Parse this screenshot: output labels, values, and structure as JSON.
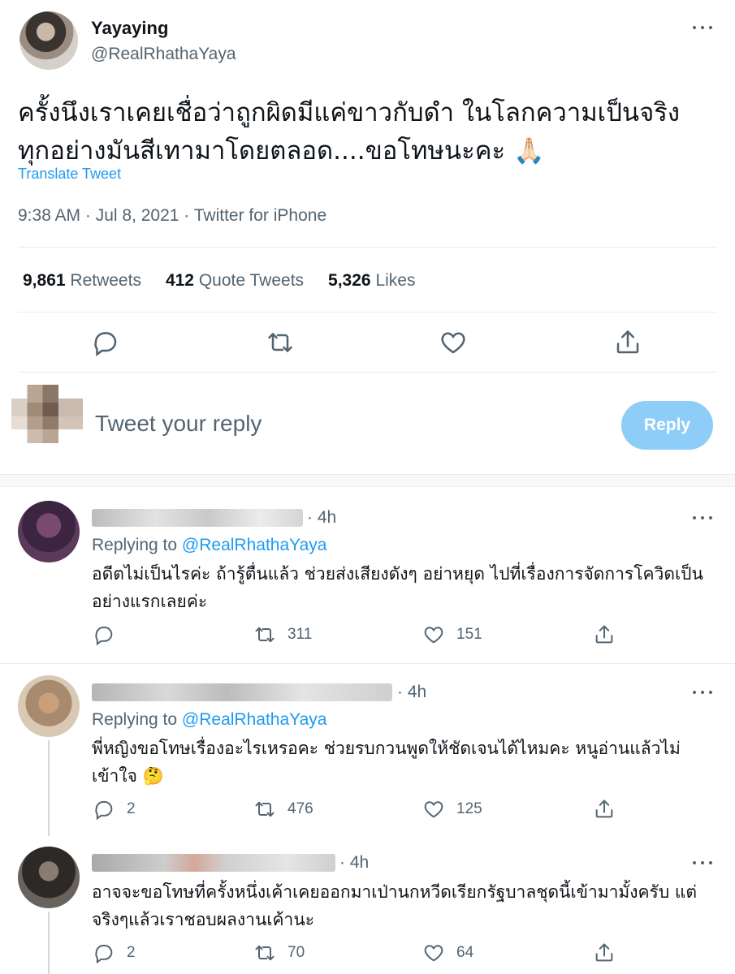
{
  "tweet": {
    "author_name": "Yayaying",
    "author_handle": "@RealRhathaYaya",
    "text": "ครั้งนึงเราเคยเชื่อว่าถูกผิดมีแค่ขาวกับดำ ในโลกความเป็นจริง ทุกอย่างมันสีเทามาโดยตลอด....ขอโทษนะคะ 🙏🏻",
    "translate_label": "Translate Tweet",
    "meta": "9:38 AM · Jul 8, 2021 · Twitter for iPhone",
    "stats": [
      {
        "count": "9,861",
        "label": "Retweets"
      },
      {
        "count": "412",
        "label": "Quote Tweets"
      },
      {
        "count": "5,326",
        "label": "Likes"
      }
    ]
  },
  "compose": {
    "placeholder": "Tweet your reply",
    "button_label": "Reply"
  },
  "replies": [
    {
      "time": "· 4h",
      "replying_prefix": "Replying to",
      "replying_handle": "@RealRhathaYaya",
      "text": "อดีตไม่เป็นไรค่ะ ถ้ารู้ตื่นแล้ว ช่วยส่งเสียงดังๆ อย่าหยุด ไปที่เรื่องการจัดการโควิดเป็นอย่างแรกเลยค่ะ",
      "comments": "",
      "retweets": "311",
      "likes": "151"
    },
    {
      "time": "· 4h",
      "replying_prefix": "Replying to",
      "replying_handle": "@RealRhathaYaya",
      "text": "พี่หญิงขอโทษเรื่องอะไรเหรอคะ ช่วยรบกวนพูดให้ชัดเจนได้ไหมคะ หนูอ่านแล้วไม่เข้าใจ 🤔",
      "comments": "2",
      "retweets": "476",
      "likes": "125"
    },
    {
      "time": "· 4h",
      "text": "อาจจะขอโทษที่ครั้งหนึ่งเค้าเคยออกมาเป่านกหวีดเรียกรัฐบาลชุดนี้เข้ามามั้งครับ แต่จริงๆแล้วเราชอบผลงานเค้านะ",
      "comments": "2",
      "retweets": "70",
      "likes": "64"
    }
  ],
  "colors": {
    "accent": "#1d9bf0",
    "reply_button": "#8ecdf8",
    "secondary_text": "#536471"
  }
}
